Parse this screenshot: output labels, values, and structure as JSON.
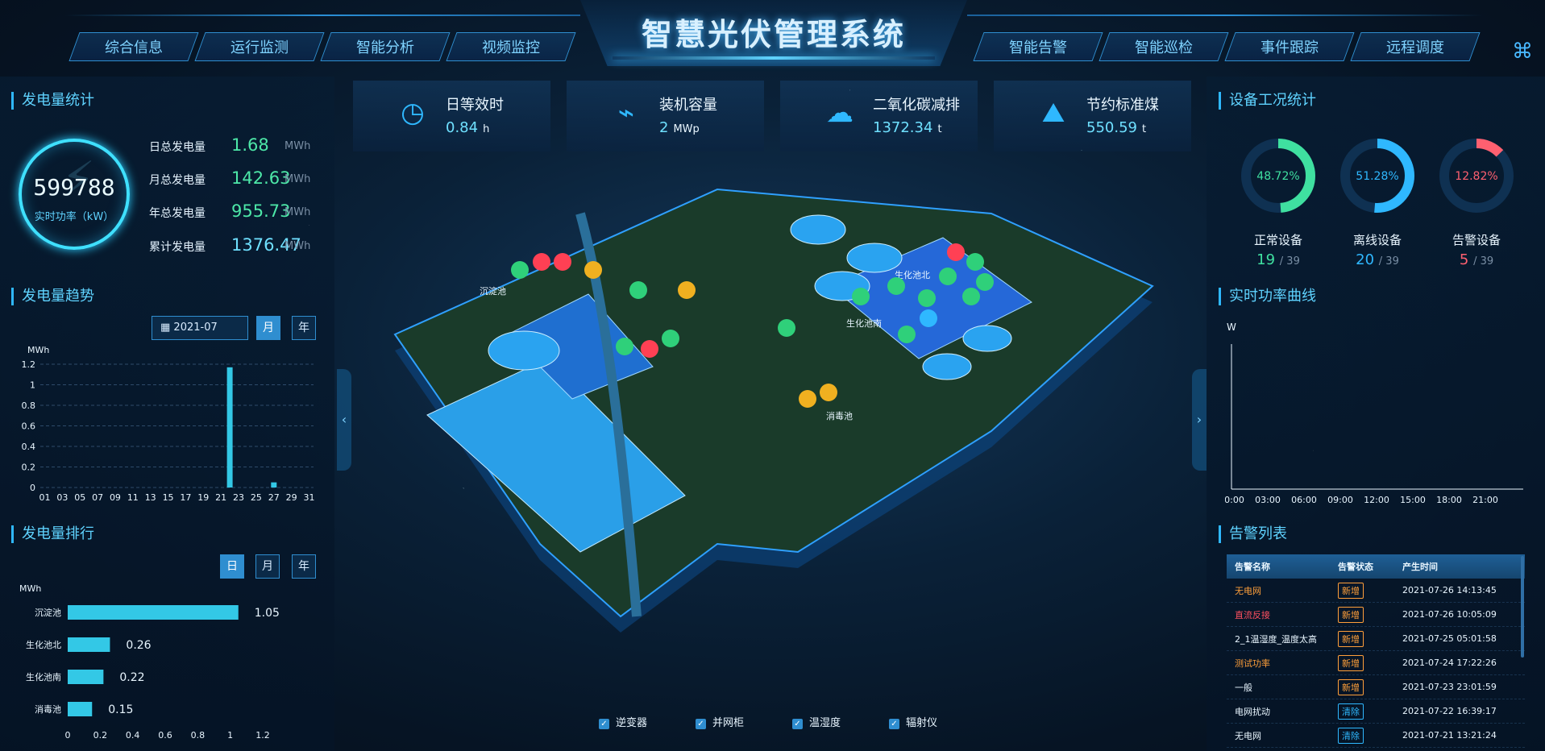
{
  "header": {
    "title": "智慧光伏管理系统",
    "nav_left": [
      "综合信息",
      "运行监测",
      "智能分析",
      "视频监控"
    ],
    "nav_right": [
      "智能告警",
      "智能巡检",
      "事件跟踪",
      "远程调度"
    ]
  },
  "generation": {
    "title": "发电量统计",
    "realtime_value": "599788",
    "realtime_label": "实时功率（kW）",
    "rows": [
      {
        "label": "日总发电量",
        "value": "1.68",
        "unit": "MWh"
      },
      {
        "label": "月总发电量",
        "value": "142.63",
        "unit": "MWh"
      },
      {
        "label": "年总发电量",
        "value": "955.73",
        "unit": "MWh"
      },
      {
        "label": "累计发电量",
        "value": "1376.47",
        "unit": "MWh"
      }
    ]
  },
  "trend": {
    "title": "发电量趋势",
    "date": "2021-07",
    "btn_month": "月",
    "btn_year": "年"
  },
  "ranking": {
    "title": "发电量排行",
    "btn_day": "日",
    "btn_month": "月",
    "btn_year": "年"
  },
  "kpis": [
    {
      "icon": "clock-24-icon",
      "label": "日等效时",
      "value": "0.84",
      "unit": "h"
    },
    {
      "icon": "capacity-icon",
      "label": "装机容量",
      "value": "2",
      "unit": "MWp"
    },
    {
      "icon": "co2-icon",
      "label": "二氧化碳减排",
      "value": "1372.34",
      "unit": "t"
    },
    {
      "icon": "coal-icon",
      "label": "节约标准煤",
      "value": "550.59",
      "unit": "t"
    }
  ],
  "devices": {
    "title": "设备工况统计",
    "items": [
      {
        "label": "正常设备",
        "pct": "48.72%",
        "count": "19",
        "total": "/ 39",
        "color": "#3fe0a0"
      },
      {
        "label": "离线设备",
        "pct": "51.28%",
        "count": "20",
        "total": "/ 39",
        "color": "#2fb8ff"
      },
      {
        "label": "告警设备",
        "pct": "12.82%",
        "count": "5",
        "total": "/ 39",
        "color": "#ff6070"
      }
    ]
  },
  "power_curve": {
    "title": "实时功率曲线",
    "unit": "W"
  },
  "alarms": {
    "title": "告警列表",
    "headers": [
      "告警名称",
      "告警状态",
      "产生时间"
    ],
    "rows": [
      {
        "name": "无电网",
        "status": "新增",
        "time": "2021-07-26 14:13:45",
        "name_color": "#ff9f3a",
        "status_color": "#ff9f3a"
      },
      {
        "name": "直流反接",
        "status": "新增",
        "time": "2021-07-26 10:05:09",
        "name_color": "#ff5060",
        "status_color": "#ff9f3a"
      },
      {
        "name": "2_1温湿度_温度太高",
        "status": "新增",
        "time": "2021-07-25 05:01:58",
        "name_color": "#e9f6ff",
        "status_color": "#ff9f3a"
      },
      {
        "name": "测试功率",
        "status": "新增",
        "time": "2021-07-24 17:22:26",
        "name_color": "#ff9f3a",
        "status_color": "#ff9f3a"
      },
      {
        "name": "一般",
        "status": "新增",
        "time": "2021-07-23 23:01:59",
        "name_color": "#e9f6ff",
        "status_color": "#ff9f3a"
      },
      {
        "name": "电网扰动",
        "status": "清除",
        "time": "2021-07-22 16:39:17",
        "name_color": "#e9f6ff",
        "status_color": "#2fb8ff"
      },
      {
        "name": "无电网",
        "status": "清除",
        "time": "2021-07-21 13:21:24",
        "name_color": "#e9f6ff",
        "status_color": "#2fb8ff"
      }
    ]
  },
  "legend": [
    "逆变器",
    "并网柜",
    "温湿度",
    "辐射仪"
  ],
  "map_labels": [
    "生化池南",
    "生化池北",
    "沉淀池",
    "消毒池"
  ],
  "chart_data": [
    {
      "type": "bar",
      "ylabel": "MWh",
      "ylim": [
        0,
        1.2
      ],
      "yticks": [
        "0",
        "0.2",
        "0.4",
        "0.6",
        "0.8",
        "1",
        "1.2"
      ],
      "categories": [
        "01",
        "03",
        "05",
        "07",
        "09",
        "11",
        "13",
        "15",
        "17",
        "19",
        "21",
        "23",
        "25",
        "27",
        "29",
        "31"
      ],
      "x": [
        22,
        27
      ],
      "values": [
        1.17,
        0.05
      ]
    },
    {
      "type": "bar",
      "ylabel": "MWh",
      "xlim": [
        0,
        1.2
      ],
      "xticks": [
        "0",
        "0.2",
        "0.4",
        "0.6",
        "0.8",
        "1",
        "1.2"
      ],
      "categories": [
        "沉淀池",
        "生化池北",
        "生化池南",
        "消毒池"
      ],
      "values": [
        1.05,
        0.26,
        0.22,
        0.15
      ]
    },
    {
      "type": "line",
      "ylabel": "W",
      "xticks": [
        "00:00",
        "03:00",
        "06:00",
        "09:00",
        "12:00",
        "15:00",
        "18:00",
        "21:00"
      ],
      "values": []
    }
  ]
}
